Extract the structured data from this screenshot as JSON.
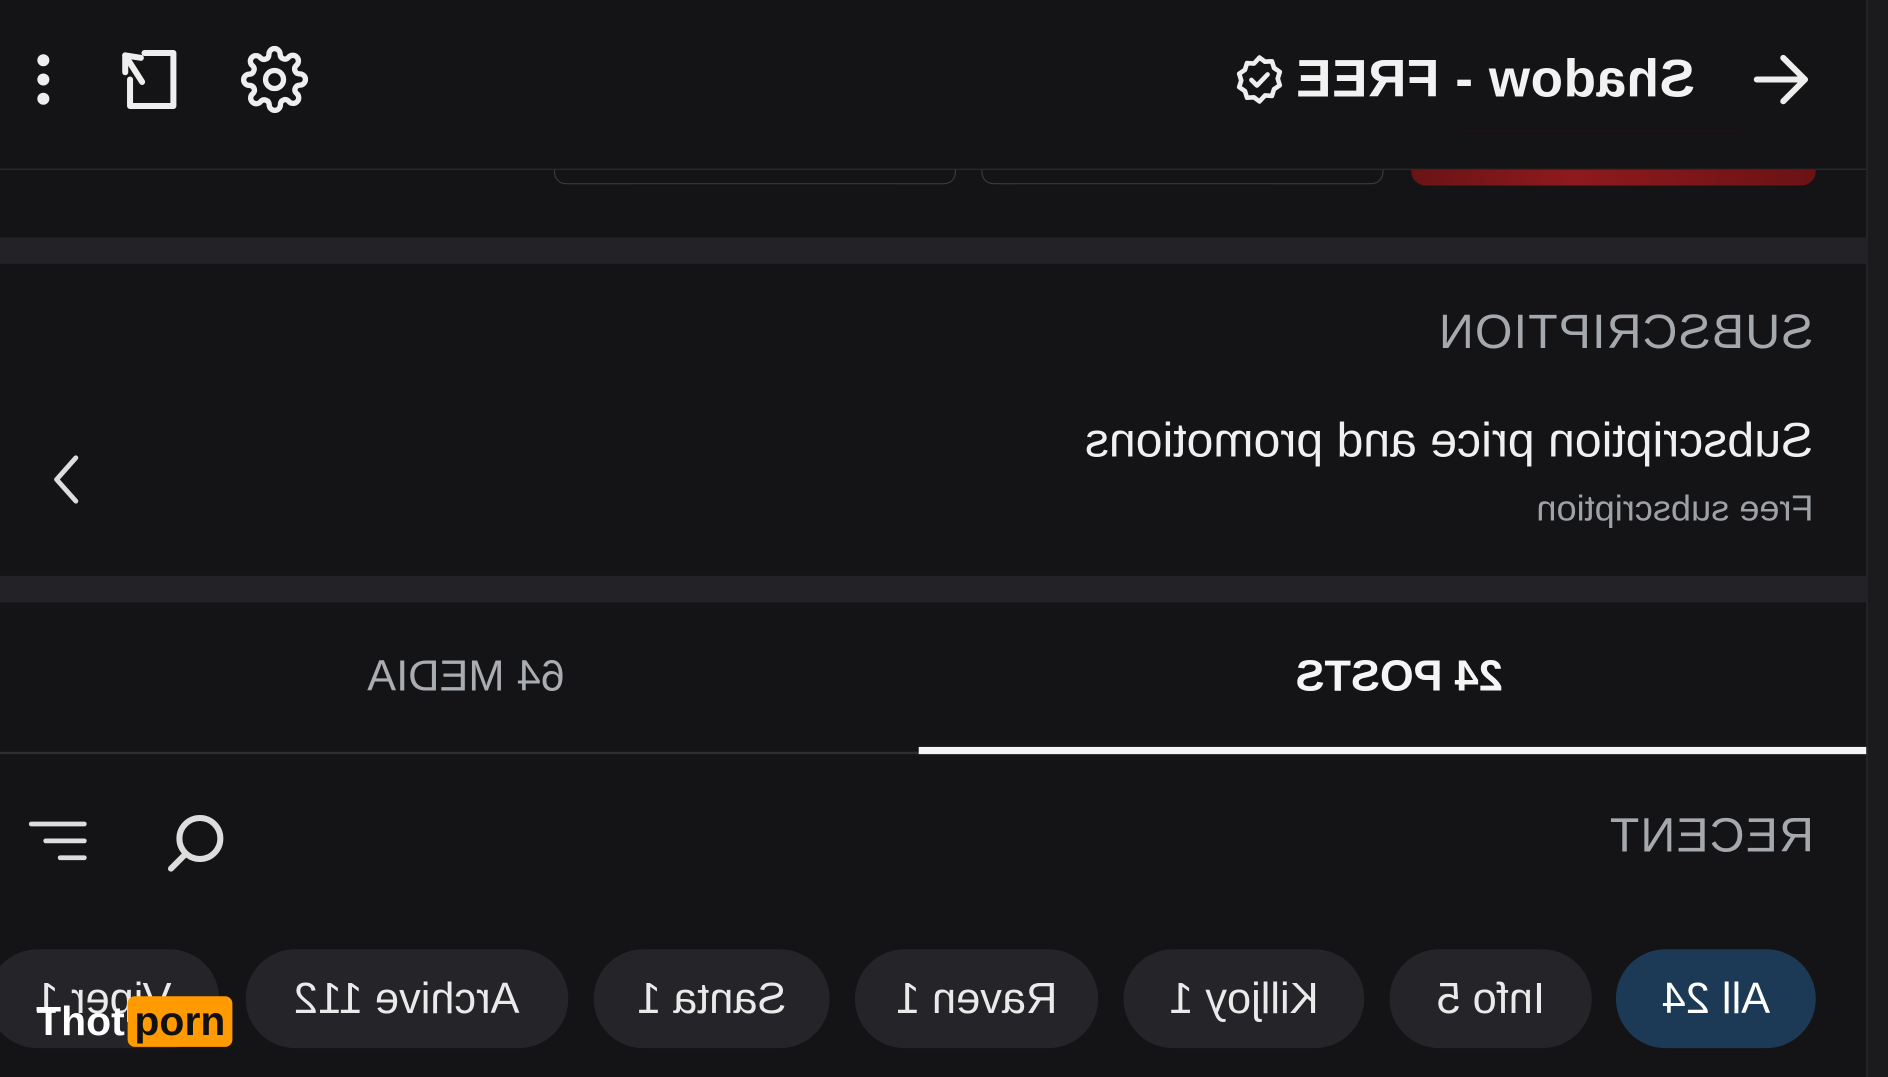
{
  "header": {
    "title": "Shadow - FREE",
    "icons": [
      "arrow-right-icon",
      "verified-badge-icon",
      "gear-icon",
      "share-icon",
      "more-vertical-icon"
    ]
  },
  "subscription": {
    "section_label": "SUBSCRIPTION",
    "title": "Subscription price and promotions",
    "value": "Free subscription"
  },
  "tabs": [
    {
      "label": "24 POSTS",
      "active": true
    },
    {
      "label": "64 MEDIA",
      "active": false
    }
  ],
  "filter": {
    "label": "RECENT"
  },
  "chips": [
    {
      "label": "All 24",
      "active": true
    },
    {
      "label": "Info 5",
      "active": false
    },
    {
      "label": "Killjoy 1",
      "active": false
    },
    {
      "label": "Raven 1",
      "active": false
    },
    {
      "label": "Santa 1",
      "active": false
    },
    {
      "label": "Archive 112",
      "active": false
    },
    {
      "label": "Viper 1",
      "active": false
    }
  ],
  "watermark": {
    "part1": "Thot",
    "part2": "porn"
  },
  "colors": {
    "background": "#141416",
    "active_chip": "#1c3a55",
    "chip": "#252529",
    "watermark_accent": "#ff9b00"
  }
}
